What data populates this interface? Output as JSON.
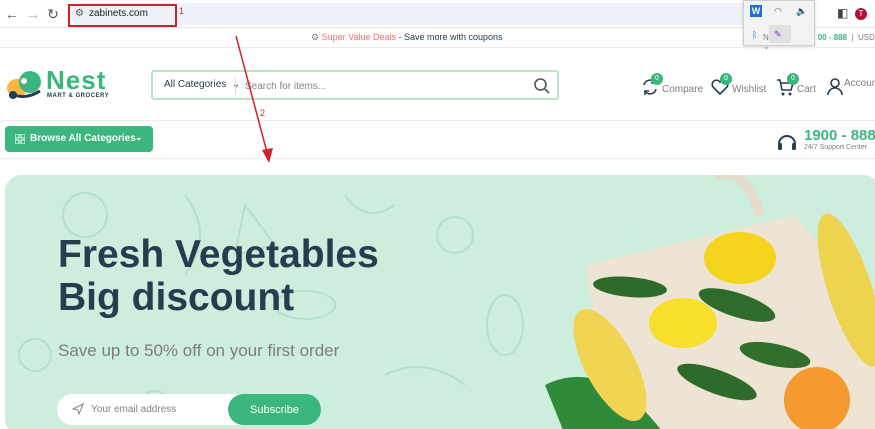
{
  "browser": {
    "url": "zabinets.com",
    "annotation_1": "1",
    "annotation_2": "2",
    "tray_w": "W",
    "avatar_initial": "T",
    "accent_red": "#d2202a"
  },
  "topbar": {
    "deal_highlight": "Super Value Deals",
    "deal_text": " - Save more with coupons",
    "phone_partial": "N",
    "phone_short": "00 - 888",
    "currency": "USD"
  },
  "header": {
    "logo_title": "Nest",
    "logo_sub": "MART & GROCERY",
    "category_select": "All Categories",
    "search_placeholder": "Search for items...",
    "compare_label": "Compare",
    "compare_count": "0",
    "wishlist_label": "Wishlist",
    "wishlist_count": "0",
    "cart_label": "Cart",
    "cart_count": "0",
    "account_label": "Account"
  },
  "nav": {
    "browse_label": "Browse  All Categories",
    "phone": "1900 - 888",
    "support": "24/7 Support Center"
  },
  "hero": {
    "title_line1": "Fresh Vegetables",
    "title_line2": "Big discount",
    "subtitle": "Save up to 50% off on your first order",
    "email_placeholder": "Your email address",
    "subscribe_label": "Subscribe"
  },
  "colors": {
    "brand_green": "#3bb77e",
    "hero_bg": "#cdeedd",
    "text_dark": "#253d4e",
    "deal_red": "#fd6e6e"
  },
  "icons": [
    "back-icon",
    "forward-icon",
    "reload-icon",
    "site-settings-icon",
    "compare-icon",
    "heart-icon",
    "cart-icon",
    "user-icon",
    "grid-icon",
    "chevron-down-icon",
    "headset-icon",
    "send-icon",
    "search-icon"
  ]
}
